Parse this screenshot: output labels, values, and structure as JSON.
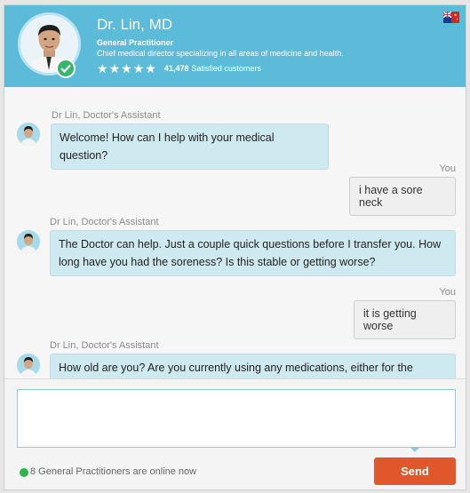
{
  "header": {
    "doctor_name": "Dr. Lin, MD",
    "title": "General Practitioner",
    "description": "Chief medical director specializing in all areas of medicine and health.",
    "stars": 5,
    "rating_count": "41,478",
    "rating_text": "Satisfied customers",
    "badge_icon": "verified-check-icon",
    "flag_icon": "australia-flag-icon"
  },
  "chat": {
    "messages": [
      {
        "from": "bot",
        "sender": "Dr Lin, Doctor's Assistant",
        "text": "Welcome! How can I help with your medical question?"
      },
      {
        "from": "user",
        "sender": "You",
        "text": "i have a sore neck"
      },
      {
        "from": "bot",
        "sender": "Dr Lin, Doctor's Assistant",
        "text": "The Doctor can help. Just a couple quick questions before I transfer you. How long have you had the soreness? Is this stable or getting worse?"
      },
      {
        "from": "user",
        "sender": "You",
        "text": "it is getting worse"
      },
      {
        "from": "bot",
        "sender": "Dr Lin, Doctor's Assistant",
        "text": "How old are you? Are you currently using any medications, either for the"
      }
    ]
  },
  "compose": {
    "input_value": "",
    "online_text": "8 General Practitioners are online now",
    "send_label": "Send"
  },
  "colors": {
    "header_bg": "#5bbbd9",
    "bot_bubble": "#cfe9f1",
    "send_button": "#e0572b",
    "online": "#2fb54a"
  }
}
